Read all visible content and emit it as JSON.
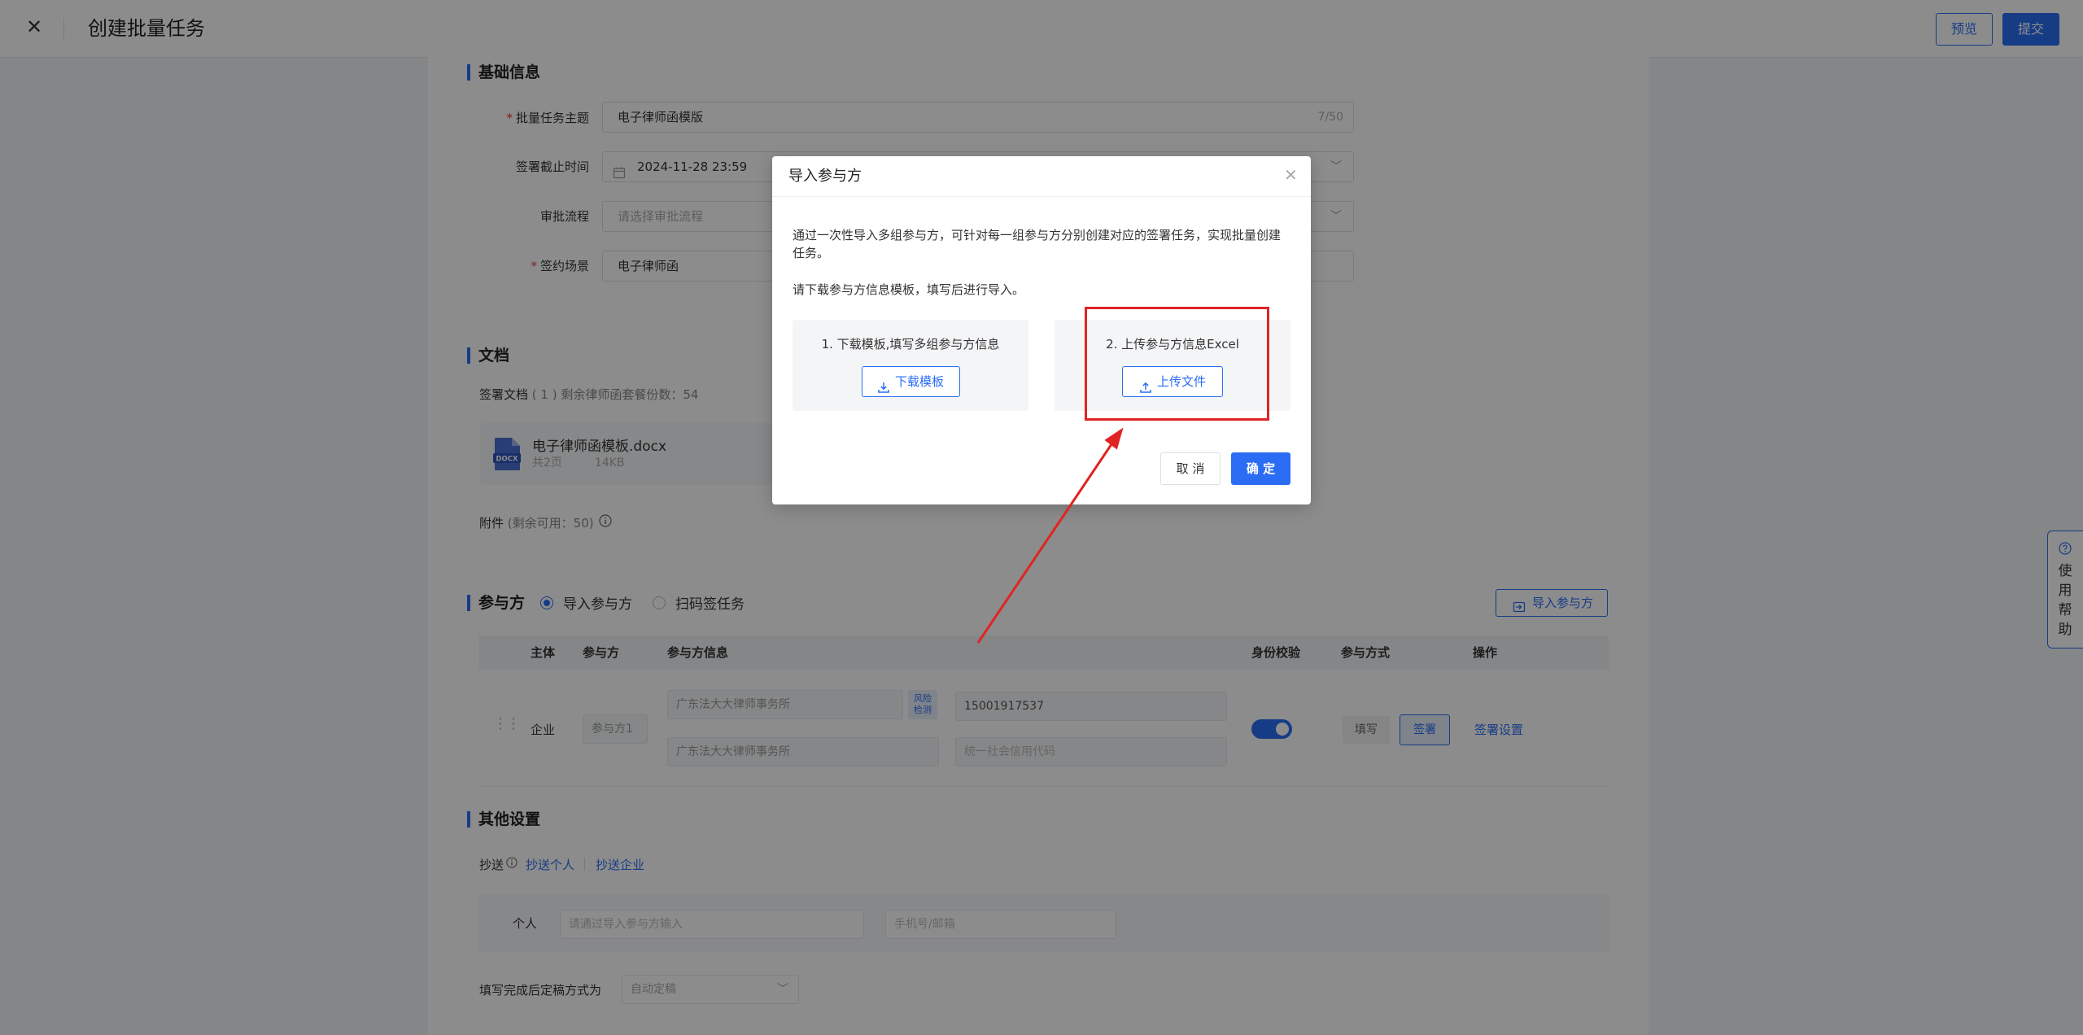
{
  "header": {
    "title": "创建批量任务",
    "preview": "预览",
    "submit": "提交"
  },
  "basic": {
    "title": "基础信息",
    "subject_label": "批量任务主题",
    "subject_value": "电子律师函模版",
    "subject_count": "7/50",
    "deadline_label": "签署截止时间",
    "deadline_value": "2024-11-28 23:59",
    "approval_label": "审批流程",
    "approval_placeholder": "请选择审批流程",
    "scene_label": "签约场景",
    "scene_value": "电子律师函"
  },
  "document": {
    "title": "文档",
    "sign_doc_label": "签署文档",
    "sign_doc_count": "( 1 )",
    "remaining": "剩余律师函套餐份数：54",
    "file_name": "电子律师函模板.docx",
    "file_ext": "DOCX",
    "file_pages": "共2页",
    "file_size": "14KB",
    "attachment_label": "附件",
    "attachment_remaining": "(剩余可用：50)"
  },
  "participants": {
    "title": "参与方",
    "mode_import": "导入参与方",
    "mode_scan": "扫码签任务",
    "import_button": "导入参与方",
    "columns": [
      "主体",
      "参与方",
      "参与方信息",
      "身份校验",
      "参与方式",
      "操作"
    ],
    "row": {
      "subject": "企业",
      "party": "参与方1",
      "company_name": "广东法大大律师事务所",
      "risk_check": "风险检测",
      "phone": "15001917537",
      "company_name2": "广东法大大律师事务所",
      "credit_code_placeholder": "统一社会信用代码",
      "fill": "填写",
      "sign": "签署",
      "sign_settings": "签署设置"
    }
  },
  "other": {
    "title": "其他设置",
    "cc_label": "抄送",
    "cc_person": "抄送个人",
    "cc_company": "抄送企业",
    "person_label": "个人",
    "person_placeholder": "请通过导入参与方输入",
    "phone_placeholder": "手机号/邮箱",
    "finalize_label": "填写完成后定稿方式为",
    "finalize_value": "自动定稿"
  },
  "modal": {
    "title": "导入参与方",
    "desc1": "通过一次性导入多组参与方，可针对每一组参与方分别创建对应的签署任务，实现批量创建任务。",
    "desc2": "请下载参与方信息模板，填写后进行导入。",
    "step1_title": "1. 下载模板,填写多组参与方信息",
    "step1_button": "下载模板",
    "step2_title": "2. 上传参与方信息Excel",
    "step2_button": "上传文件",
    "cancel": "取 消",
    "ok": "确 定"
  },
  "help": {
    "label": "使用帮助"
  },
  "colors": {
    "accent": "#2a6df4",
    "highlight": "#e02424"
  },
  "icons": [
    "close-icon",
    "calendar-icon",
    "chevron-down-icon",
    "docx-file-icon",
    "info-icon",
    "import-icon",
    "drag-handle-icon",
    "download-icon",
    "upload-icon",
    "help-icon"
  ]
}
